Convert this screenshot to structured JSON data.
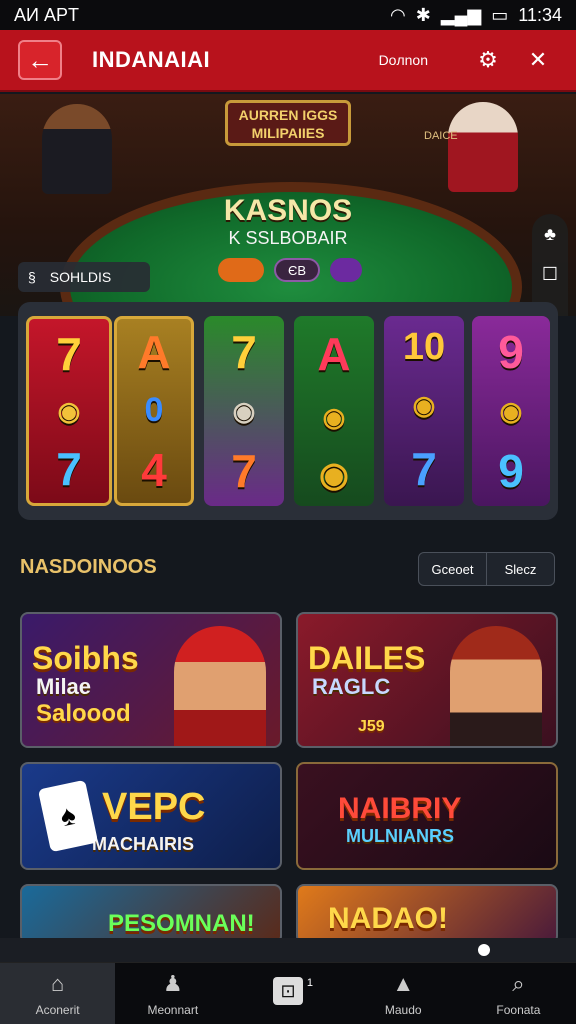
{
  "status": {
    "carrier": "AИ APT",
    "time": "11:34"
  },
  "appbar": {
    "title": "INDANAIAI",
    "account": "Doлnon"
  },
  "hero": {
    "sign_line1": "AURREN IGGS",
    "sign_line2": "MILIPAIIES",
    "sign_line3": "DAICE",
    "table_title": "KASNOS",
    "table_sub": "K SSLBOBAIR",
    "chip_mid": "ЄB",
    "sold_label": "SOHLDIS"
  },
  "reels": [
    {
      "top": "7",
      "mid": "◉",
      "bottom": "7"
    },
    {
      "top": "A",
      "mid": "0",
      "bottom": "4"
    },
    {
      "top": "7",
      "mid": "◉",
      "bottom": "7"
    },
    {
      "top": "A",
      "mid": "◉",
      "bottom": "◉"
    },
    {
      "top": "10",
      "mid": "◉",
      "bottom": "7"
    },
    {
      "top": "9",
      "mid": "◉",
      "bottom": "9"
    }
  ],
  "section": {
    "title": "NASDOINOOS",
    "btn_a": "Gceoet",
    "btn_b": "Slecz"
  },
  "cards": [
    {
      "l1": "Soibhs",
      "l2": "Milae",
      "l3": "Saloood"
    },
    {
      "l1": "DAILES",
      "l2": "RAGLC",
      "l3": "J59"
    },
    {
      "l1": "VEPC",
      "l2": "MACHAIRIS",
      "l3": ""
    },
    {
      "l1": "NAIBRIY",
      "l2": "MULNIANRS",
      "l3": ""
    },
    {
      "l1": "PESOMNAN!",
      "l2": "",
      "l3": ""
    },
    {
      "l1": "NADAO!",
      "l2": "",
      "l3": ""
    }
  ],
  "tabs": [
    {
      "label": "Aconerit",
      "icon": "home-icon"
    },
    {
      "label": "Meonnart",
      "icon": "users-icon"
    },
    {
      "label": "",
      "icon": "game-icon",
      "badge": "1"
    },
    {
      "label": "Maudo",
      "icon": "profile-icon"
    },
    {
      "label": "Foonata",
      "icon": "search-icon"
    }
  ],
  "colors": {
    "accent": "#b8121c",
    "gold": "#e9c26a",
    "felt": "#1f8d3e"
  }
}
